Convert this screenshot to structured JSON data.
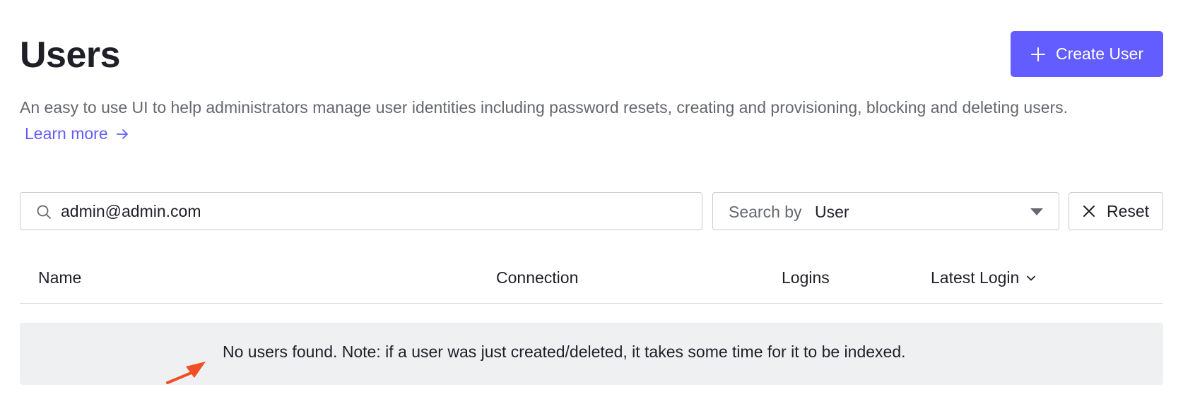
{
  "header": {
    "title": "Users",
    "create_button_label": "Create User"
  },
  "description": {
    "text": "An easy to use UI to help administrators manage user identities including password resets, creating and provisioning, blocking and deleting users.",
    "learn_more_label": "Learn more"
  },
  "search": {
    "value": "admin@admin.com",
    "search_by_label": "Search by",
    "search_by_value": "User",
    "reset_label": "Reset"
  },
  "table": {
    "columns": [
      "Name",
      "Connection",
      "Logins",
      "Latest Login"
    ],
    "empty_message": "No users found. Note: if a user was just created/deleted, it takes some time for it to be indexed."
  },
  "colors": {
    "accent": "#635dff",
    "annotation_arrow": "#f04e23",
    "empty_bg": "#eff0f2"
  },
  "icons": {
    "create": "plus-icon",
    "learn_more": "arrow-right-icon",
    "search": "search-icon",
    "search_by": "caret-down-icon",
    "reset": "close-icon",
    "sort": "chevron-down-icon",
    "annotation": "annotation-arrow-icon"
  }
}
